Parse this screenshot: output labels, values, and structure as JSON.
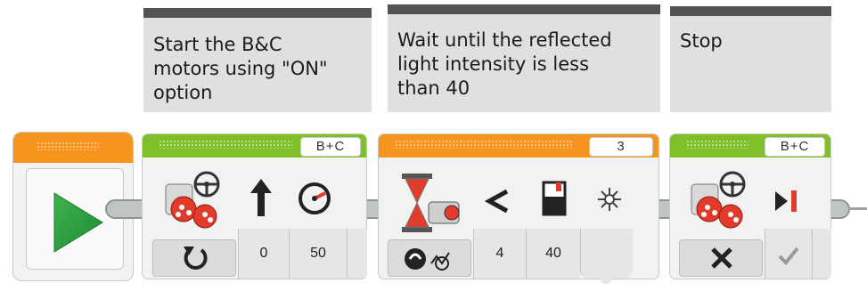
{
  "comments": [
    {
      "text": "Start the B&C\nmotors using \"ON\"\noption"
    },
    {
      "text": "Wait until the reflected\nlight intensity is less\nthan 40"
    },
    {
      "text": "Stop"
    }
  ],
  "blocks": {
    "start": {
      "icon": "play-icon"
    },
    "motor_on": {
      "port": "B+C",
      "mode": "rotate-icon",
      "params": [
        "0",
        "50"
      ],
      "icons": [
        "move-steering-icon",
        "steering-arrow-icon",
        "power-gauge-icon"
      ]
    },
    "wait": {
      "port": "3",
      "mode": "compare-icon",
      "params": [
        "4",
        "40"
      ],
      "icons": [
        "hourglass-color-sensor-icon",
        "less-than-icon",
        "threshold-icon",
        "light-icon"
      ]
    },
    "motor_off": {
      "port": "B+C",
      "mode": "x-icon",
      "check": "check-icon",
      "icons": [
        "move-steering-icon",
        "brake-icon"
      ]
    }
  },
  "colors": {
    "action_block": "#7fbf2a",
    "flow_block": "#f7941d",
    "comment_bar": "#545454",
    "comment_bg": "#e0e0e0"
  }
}
